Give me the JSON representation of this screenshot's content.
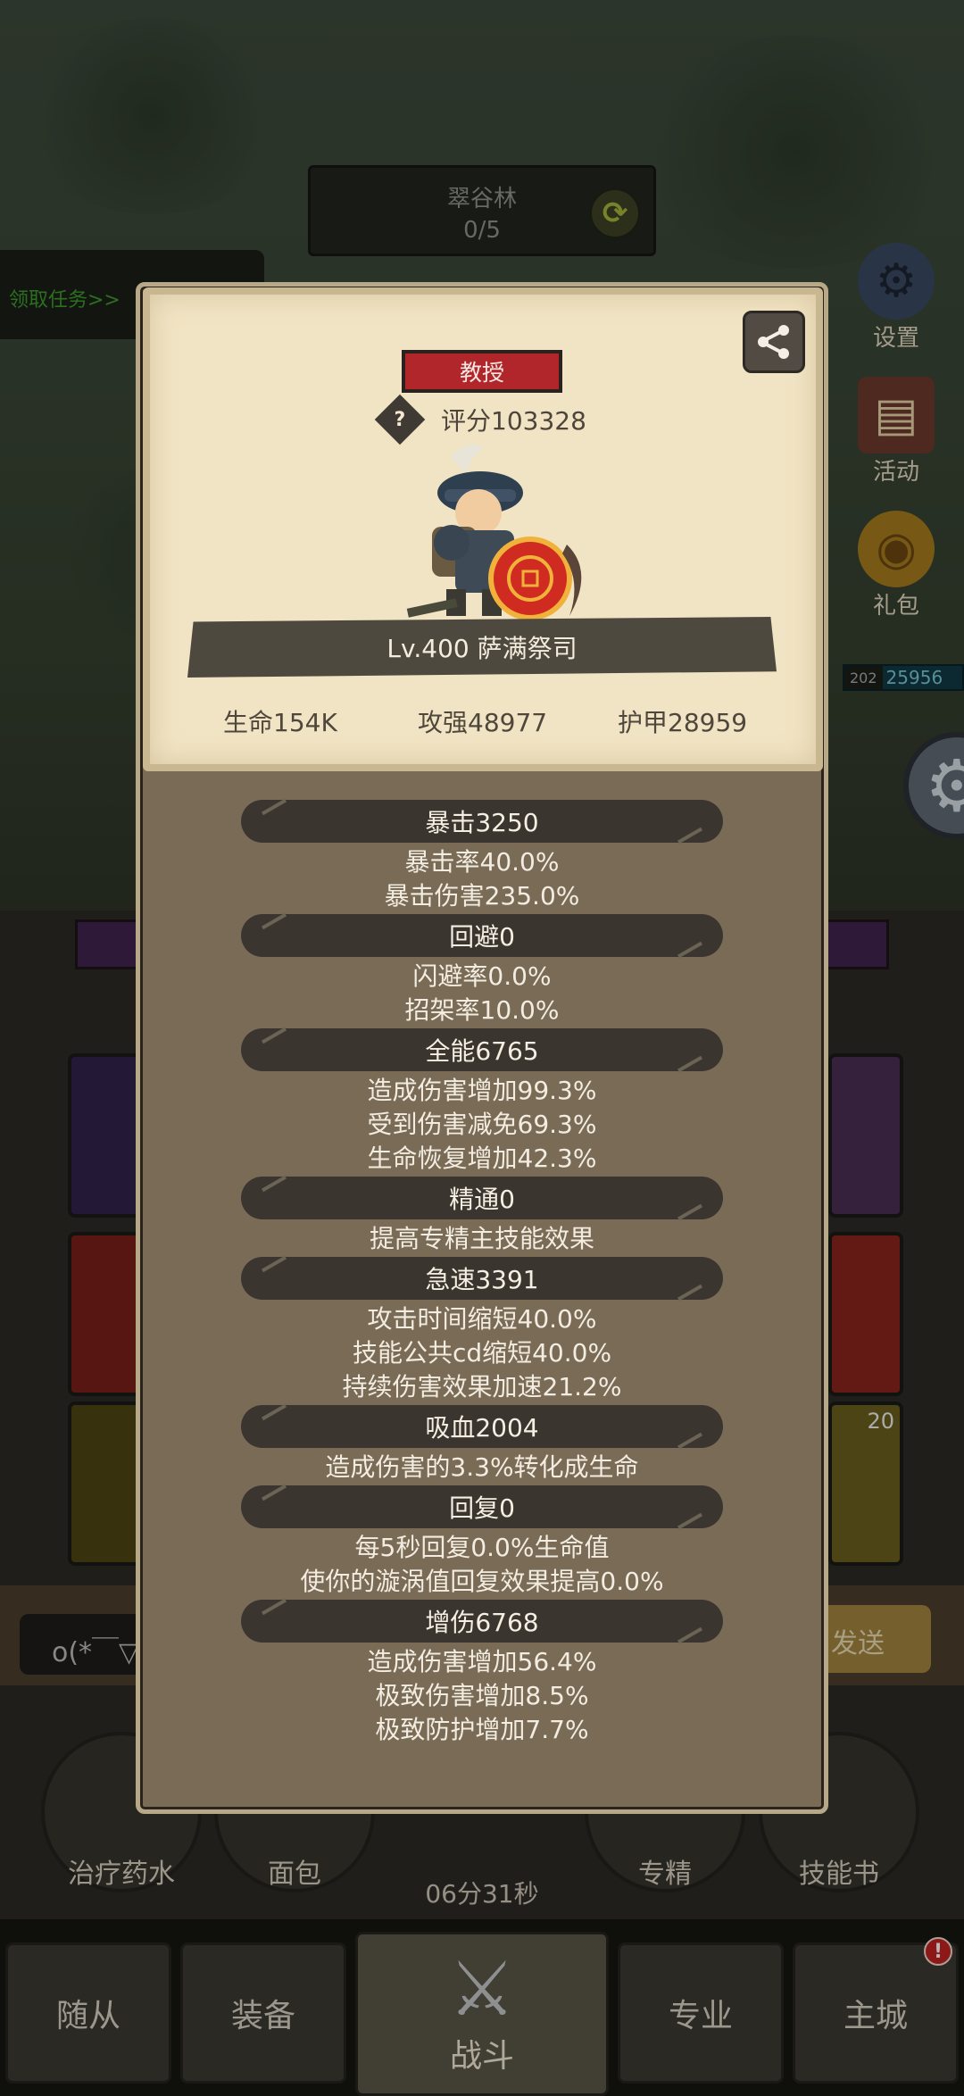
{
  "zone": {
    "name": "翠谷林",
    "progress": "0/5"
  },
  "task_banner": "领取任务>>",
  "right_menu": [
    {
      "label": "设置",
      "icon": "gear-icon"
    },
    {
      "label": "活动",
      "icon": "scroll-icon"
    },
    {
      "label": "礼包",
      "icon": "gift-icon"
    }
  ],
  "enemy_bar": {
    "level": "202",
    "value": "25956"
  },
  "chat": {
    "input_text": "o(*￣▽",
    "send_label": "发送"
  },
  "consumables": [
    "治疗药水",
    "面包",
    "专精",
    "技能书"
  ],
  "timer": "06分31秒",
  "bottom_nav": [
    "随从",
    "装备",
    "战斗",
    "专业",
    "主城"
  ],
  "nav_alert": "!",
  "hero_card": {
    "rank": "教授",
    "score": "评分103328",
    "name": "Lv.400 萨满祭司",
    "life": "生命154K",
    "attack": "攻强48977",
    "armor": "护甲28959"
  },
  "stats": [
    {
      "header": "暴击3250",
      "lines": [
        "暴击率40.0%",
        "暴击伤害235.0%"
      ]
    },
    {
      "header": "回避0",
      "lines": [
        "闪避率0.0%",
        "招架率10.0%"
      ]
    },
    {
      "header": "全能6765",
      "lines": [
        "造成伤害增加99.3%",
        "受到伤害减免69.3%",
        "生命恢复增加42.3%"
      ]
    },
    {
      "header": "精通0",
      "lines": [
        "提高专精主技能效果"
      ]
    },
    {
      "header": "急速3391",
      "lines": [
        "攻击时间缩短40.0%",
        "技能公共cd缩短40.0%",
        "持续伤害效果加速21.2%"
      ]
    },
    {
      "header": "吸血2004",
      "lines": [
        "造成伤害的3.3%转化成生命"
      ]
    },
    {
      "header": "回复0",
      "lines": [
        "每5秒回复0.0%生命值",
        "使你的漩涡值回复效果提高0.0%"
      ]
    },
    {
      "header": "增伤6768",
      "lines": [
        "造成伤害增加56.4%",
        "极致伤害增加8.5%",
        "极致防护增加7.7%"
      ]
    }
  ],
  "tile_badge": "20"
}
